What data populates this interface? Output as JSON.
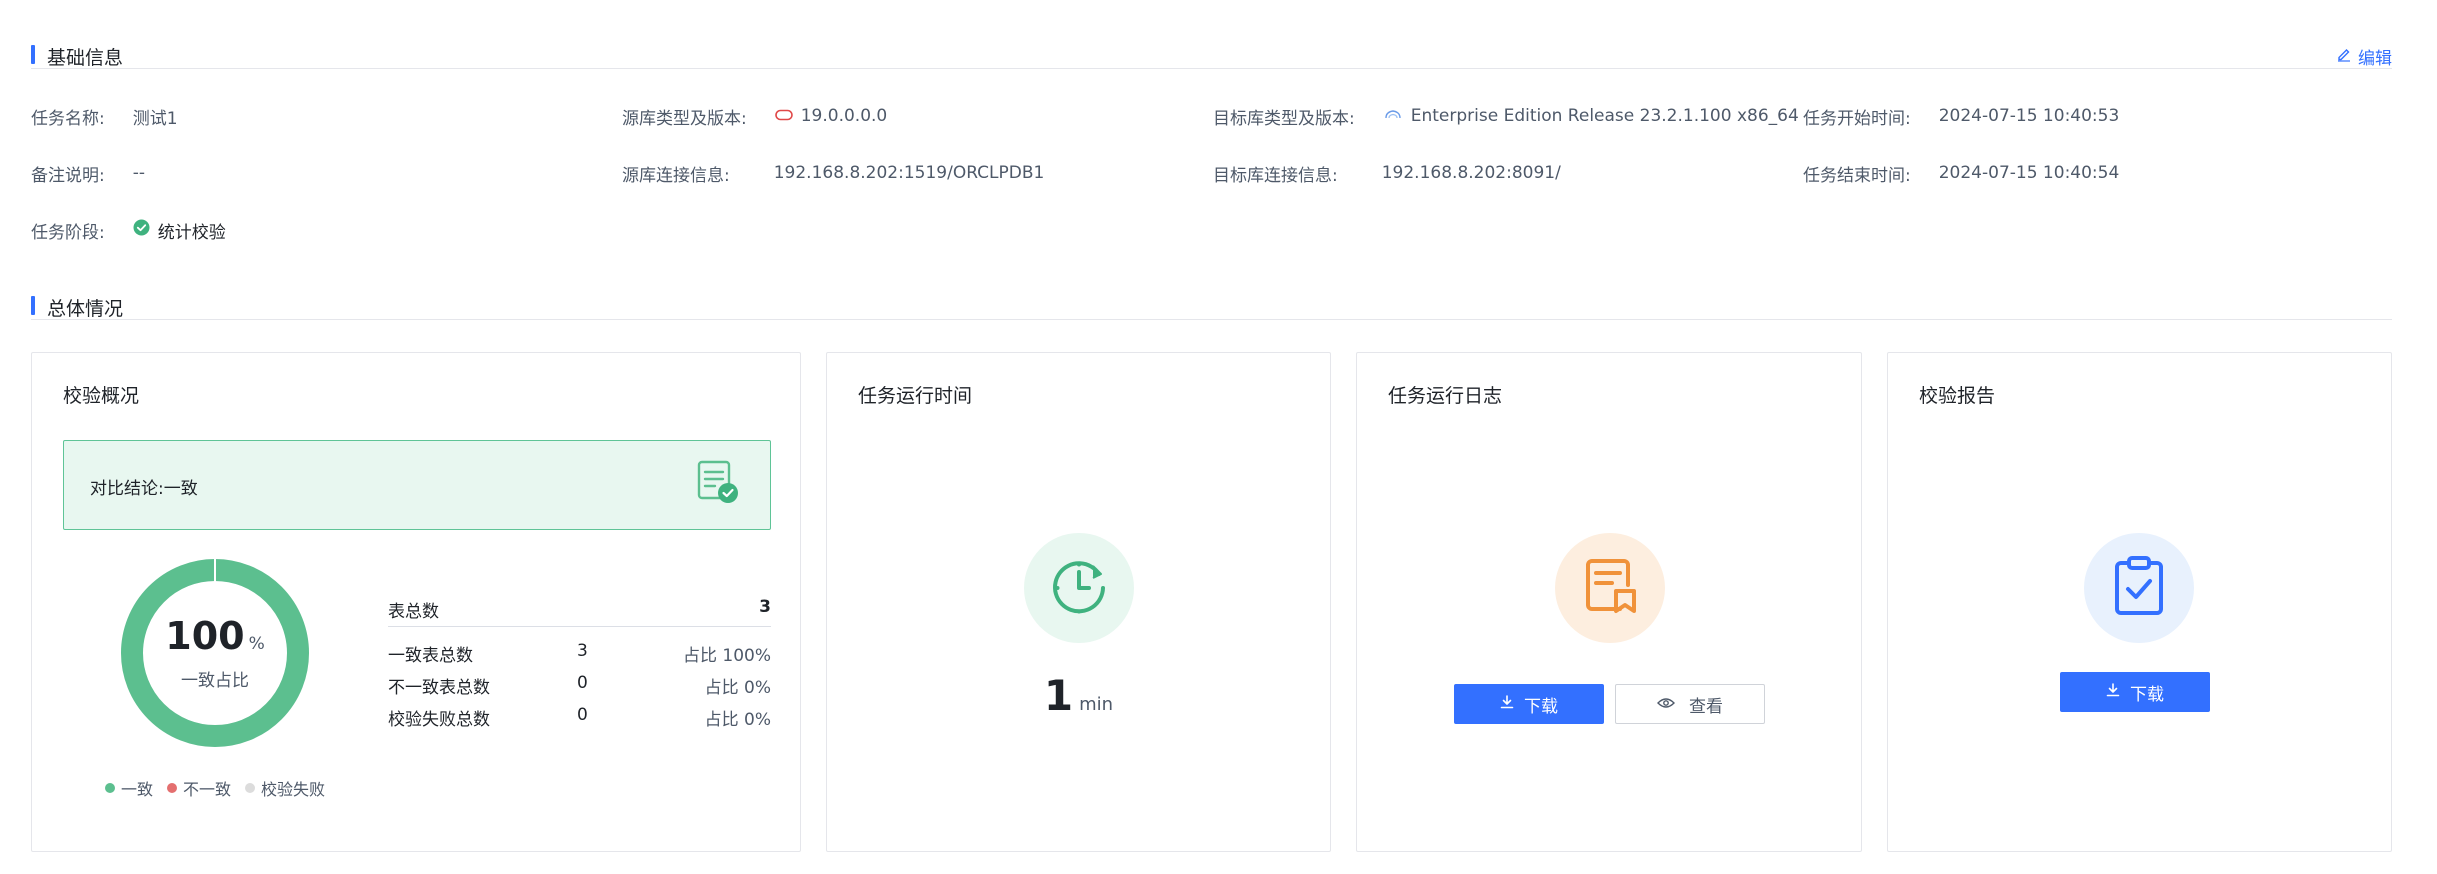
{
  "sections": {
    "basic_info": "基础信息",
    "overview": "总体情况",
    "edit_label": "编辑"
  },
  "info": {
    "task_name_label": "任务名称:",
    "task_name_value": "测试1",
    "source_type_label": "源库类型及版本:",
    "source_type_value": "19.0.0.0.0",
    "target_type_label": "目标库类型及版本:",
    "target_type_value": "Enterprise Edition Release 23.2.1.100 x86_64",
    "start_time_label": "任务开始时间:",
    "start_time_value": "2024-07-15 10:40:53",
    "remark_label": "备注说明:",
    "remark_value": "--",
    "source_conn_label": "源库连接信息:",
    "source_conn_value": "192.168.8.202:1519/ORCLPDB1",
    "target_conn_label": "目标库连接信息:",
    "target_conn_value": "192.168.8.202:8091/",
    "end_time_label": "任务结束时间:",
    "end_time_value": "2024-07-15 10:40:54",
    "stage_label": "任务阶段:",
    "stage_value": "统计校验"
  },
  "cards": {
    "check_overview": {
      "title": "校验概况",
      "conclusion": "对比结论:一致",
      "donut_value": "100",
      "donut_unit": "%",
      "donut_caption": "一致占比",
      "consistent_ratio": 1.0,
      "total_label": "表总数",
      "total_value": "3",
      "rows": [
        {
          "label": "一致表总数",
          "count": "3",
          "pct": "占比 100%"
        },
        {
          "label": "不一致表总数",
          "count": "0",
          "pct": "占比 0%"
        },
        {
          "label": "校验失败总数",
          "count": "0",
          "pct": "占比 0%"
        }
      ],
      "legend": [
        {
          "label": "一致",
          "color": "#5cbf8f"
        },
        {
          "label": "不一致",
          "color": "#e46f6f"
        },
        {
          "label": "校验失败",
          "color": "#dcdcdc"
        }
      ]
    },
    "runtime": {
      "title": "任务运行时间",
      "value": "1",
      "unit": "min"
    },
    "log": {
      "title": "任务运行日志",
      "download_label": "下载",
      "view_label": "查看"
    },
    "report": {
      "title": "校验报告",
      "download_label": "下载"
    }
  },
  "colors": {
    "accent": "#3370ff",
    "success": "#5cbf8f",
    "log_orange": "#f0923a"
  }
}
